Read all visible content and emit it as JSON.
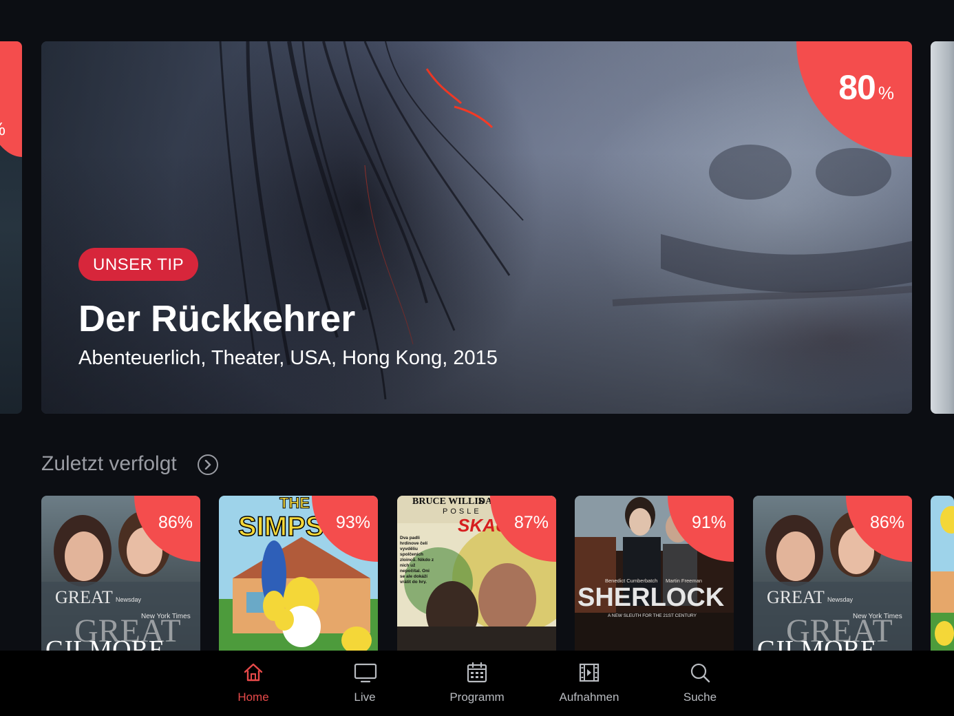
{
  "colors": {
    "background": "#0c0e13",
    "accent": "#f44d4d",
    "tip_badge": "#d7263b",
    "nav_active": "#e84a4a",
    "nav_inactive": "#b9bcc1",
    "section_title": "#9a9ca3"
  },
  "hero_prev": {
    "score_unit": "%"
  },
  "hero": {
    "score_value": "80",
    "score_unit": "%",
    "tip_label": "UNSER TIP",
    "title": "Der Rückkehrer",
    "meta": "Abenteuerlich, Theater, USA, Hong Kong, 2015"
  },
  "recent": {
    "title": "Zuletzt verfolgt",
    "arrow_icon": "chevron-right-circle-icon",
    "items": [
      {
        "score": "86%",
        "poster_text": [
          "GREAT",
          "Newsday",
          "New York Times",
          "GREAT",
          "GILMORE"
        ]
      },
      {
        "score": "93%",
        "poster_text": [
          "THE",
          "SIMPS"
        ]
      },
      {
        "score": "87%",
        "poster_text": [
          "BRUCE WILLIS",
          "DA",
          "POSLE",
          "SKAU",
          "Dva padli hrdinove čelí vyvděliu spolčeních zloinců. Nikdo z nich už nepočítal. Oni se ale dokáží vrátit do hry."
        ]
      },
      {
        "score": "91%",
        "poster_text": [
          "Benedict Cumberbatch",
          "Martin Freeman",
          "SHERLOCK",
          "A NEW SLEUTH FOR THE 21ST CENTURY"
        ]
      },
      {
        "score": "86%",
        "poster_text": [
          "GREAT",
          "Newsday",
          "New York Times",
          "GREAT",
          "GILMORE"
        ]
      }
    ]
  },
  "nav": {
    "items": [
      {
        "label": "Home",
        "icon": "home-icon",
        "active": true
      },
      {
        "label": "Live",
        "icon": "tv-icon",
        "active": false
      },
      {
        "label": "Programm",
        "icon": "calendar-icon",
        "active": false
      },
      {
        "label": "Aufnahmen",
        "icon": "film-icon",
        "active": false
      },
      {
        "label": "Suche",
        "icon": "search-icon",
        "active": false
      }
    ]
  }
}
